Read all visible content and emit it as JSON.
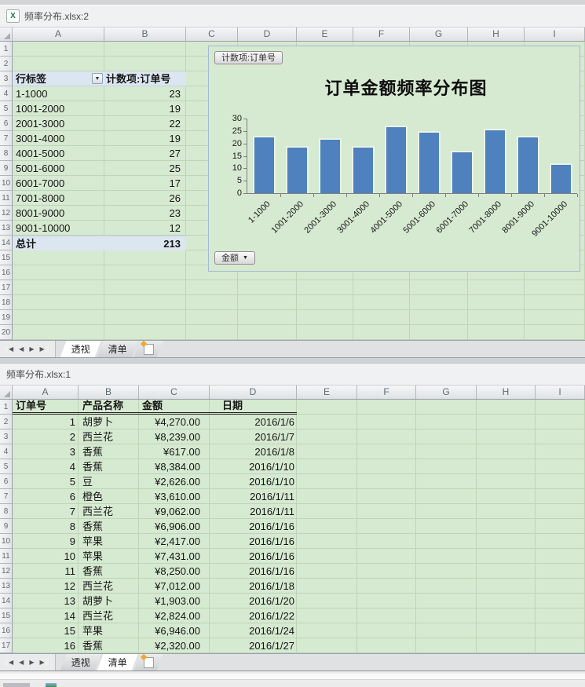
{
  "top_window": {
    "title": "频率分布.xlsx:2",
    "column_letters": [
      "A",
      "B",
      "C",
      "D",
      "E",
      "F",
      "G",
      "H",
      "I"
    ],
    "row_numbers": [
      1,
      2,
      3,
      4,
      5,
      6,
      7,
      8,
      9,
      10,
      11,
      12,
      13,
      14,
      15,
      16,
      17,
      18,
      19,
      20
    ],
    "pivot": {
      "row_label_header": "行标签",
      "value_header": "计数项:订单号",
      "rows": [
        {
          "label": "1-1000",
          "value": "23"
        },
        {
          "label": "1001-2000",
          "value": "19"
        },
        {
          "label": "2001-3000",
          "value": "22"
        },
        {
          "label": "3001-4000",
          "value": "19"
        },
        {
          "label": "4001-5000",
          "value": "27"
        },
        {
          "label": "5001-6000",
          "value": "25"
        },
        {
          "label": "6001-7000",
          "value": "17"
        },
        {
          "label": "7001-8000",
          "value": "26"
        },
        {
          "label": "8001-9000",
          "value": "23"
        },
        {
          "label": "9001-10000",
          "value": "12"
        }
      ],
      "total_label": "总计",
      "total_value": "213"
    },
    "tabs": [
      {
        "label": "透视",
        "active": true
      },
      {
        "label": "清单",
        "active": false
      }
    ]
  },
  "bottom_window": {
    "title": "频率分布.xlsx:1",
    "column_letters": [
      "A",
      "B",
      "C",
      "D",
      "E",
      "F",
      "G",
      "H",
      "I"
    ],
    "row_numbers": [
      1,
      2,
      3,
      4,
      5,
      6,
      7,
      8,
      9,
      10,
      11,
      12,
      13,
      14,
      15,
      16,
      17
    ],
    "table": {
      "headers": [
        "订单号",
        "产品名称",
        "金额",
        "日期"
      ],
      "rows": [
        [
          "1",
          "胡萝卜",
          "¥4,270.00",
          "2016/1/6"
        ],
        [
          "2",
          "西兰花",
          "¥8,239.00",
          "2016/1/7"
        ],
        [
          "3",
          "香蕉",
          "¥617.00",
          "2016/1/8"
        ],
        [
          "4",
          "香蕉",
          "¥8,384.00",
          "2016/1/10"
        ],
        [
          "5",
          "豆",
          "¥2,626.00",
          "2016/1/10"
        ],
        [
          "6",
          "橙色",
          "¥3,610.00",
          "2016/1/11"
        ],
        [
          "7",
          "西兰花",
          "¥9,062.00",
          "2016/1/11"
        ],
        [
          "8",
          "香蕉",
          "¥6,906.00",
          "2016/1/16"
        ],
        [
          "9",
          "苹果",
          "¥2,417.00",
          "2016/1/16"
        ],
        [
          "10",
          "苹果",
          "¥7,431.00",
          "2016/1/16"
        ],
        [
          "11",
          "香蕉",
          "¥8,250.00",
          "2016/1/16"
        ],
        [
          "12",
          "西兰花",
          "¥7,012.00",
          "2016/1/18"
        ],
        [
          "13",
          "胡萝卜",
          "¥1,903.00",
          "2016/1/20"
        ],
        [
          "14",
          "西兰花",
          "¥2,824.00",
          "2016/1/22"
        ],
        [
          "15",
          "苹果",
          "¥6,946.00",
          "2016/1/24"
        ],
        [
          "16",
          "香蕉",
          "¥2,320.00",
          "2016/1/27"
        ]
      ]
    },
    "tabs": [
      {
        "label": "透视",
        "active": false
      },
      {
        "label": "清单",
        "active": true
      }
    ]
  },
  "chart_data": {
    "type": "bar",
    "title": "订单金额频率分布图",
    "categories": [
      "1-1000",
      "1001-2000",
      "2001-3000",
      "3001-4000",
      "4001-5000",
      "5001-6000",
      "6001-7000",
      "7001-8000",
      "8001-9000",
      "9001-10000"
    ],
    "values": [
      23,
      19,
      22,
      19,
      27,
      25,
      17,
      26,
      23,
      12
    ],
    "ylim": [
      0,
      30
    ],
    "ytick_step": 5,
    "xlabel": "",
    "ylabel": "",
    "legend": "none",
    "grid": "off",
    "field_button_label": "计数项:订单号",
    "axis_field_button_label": "金额",
    "bar_color": "#4e81bd"
  },
  "icons": {
    "dropdown_arrow": "▼"
  },
  "colors": {
    "sheet_background": "#d6e9d1",
    "gridline": "#bed5b7",
    "pivot_header_background": "#dce6f1",
    "bar_fill": "#4e81bd"
  }
}
